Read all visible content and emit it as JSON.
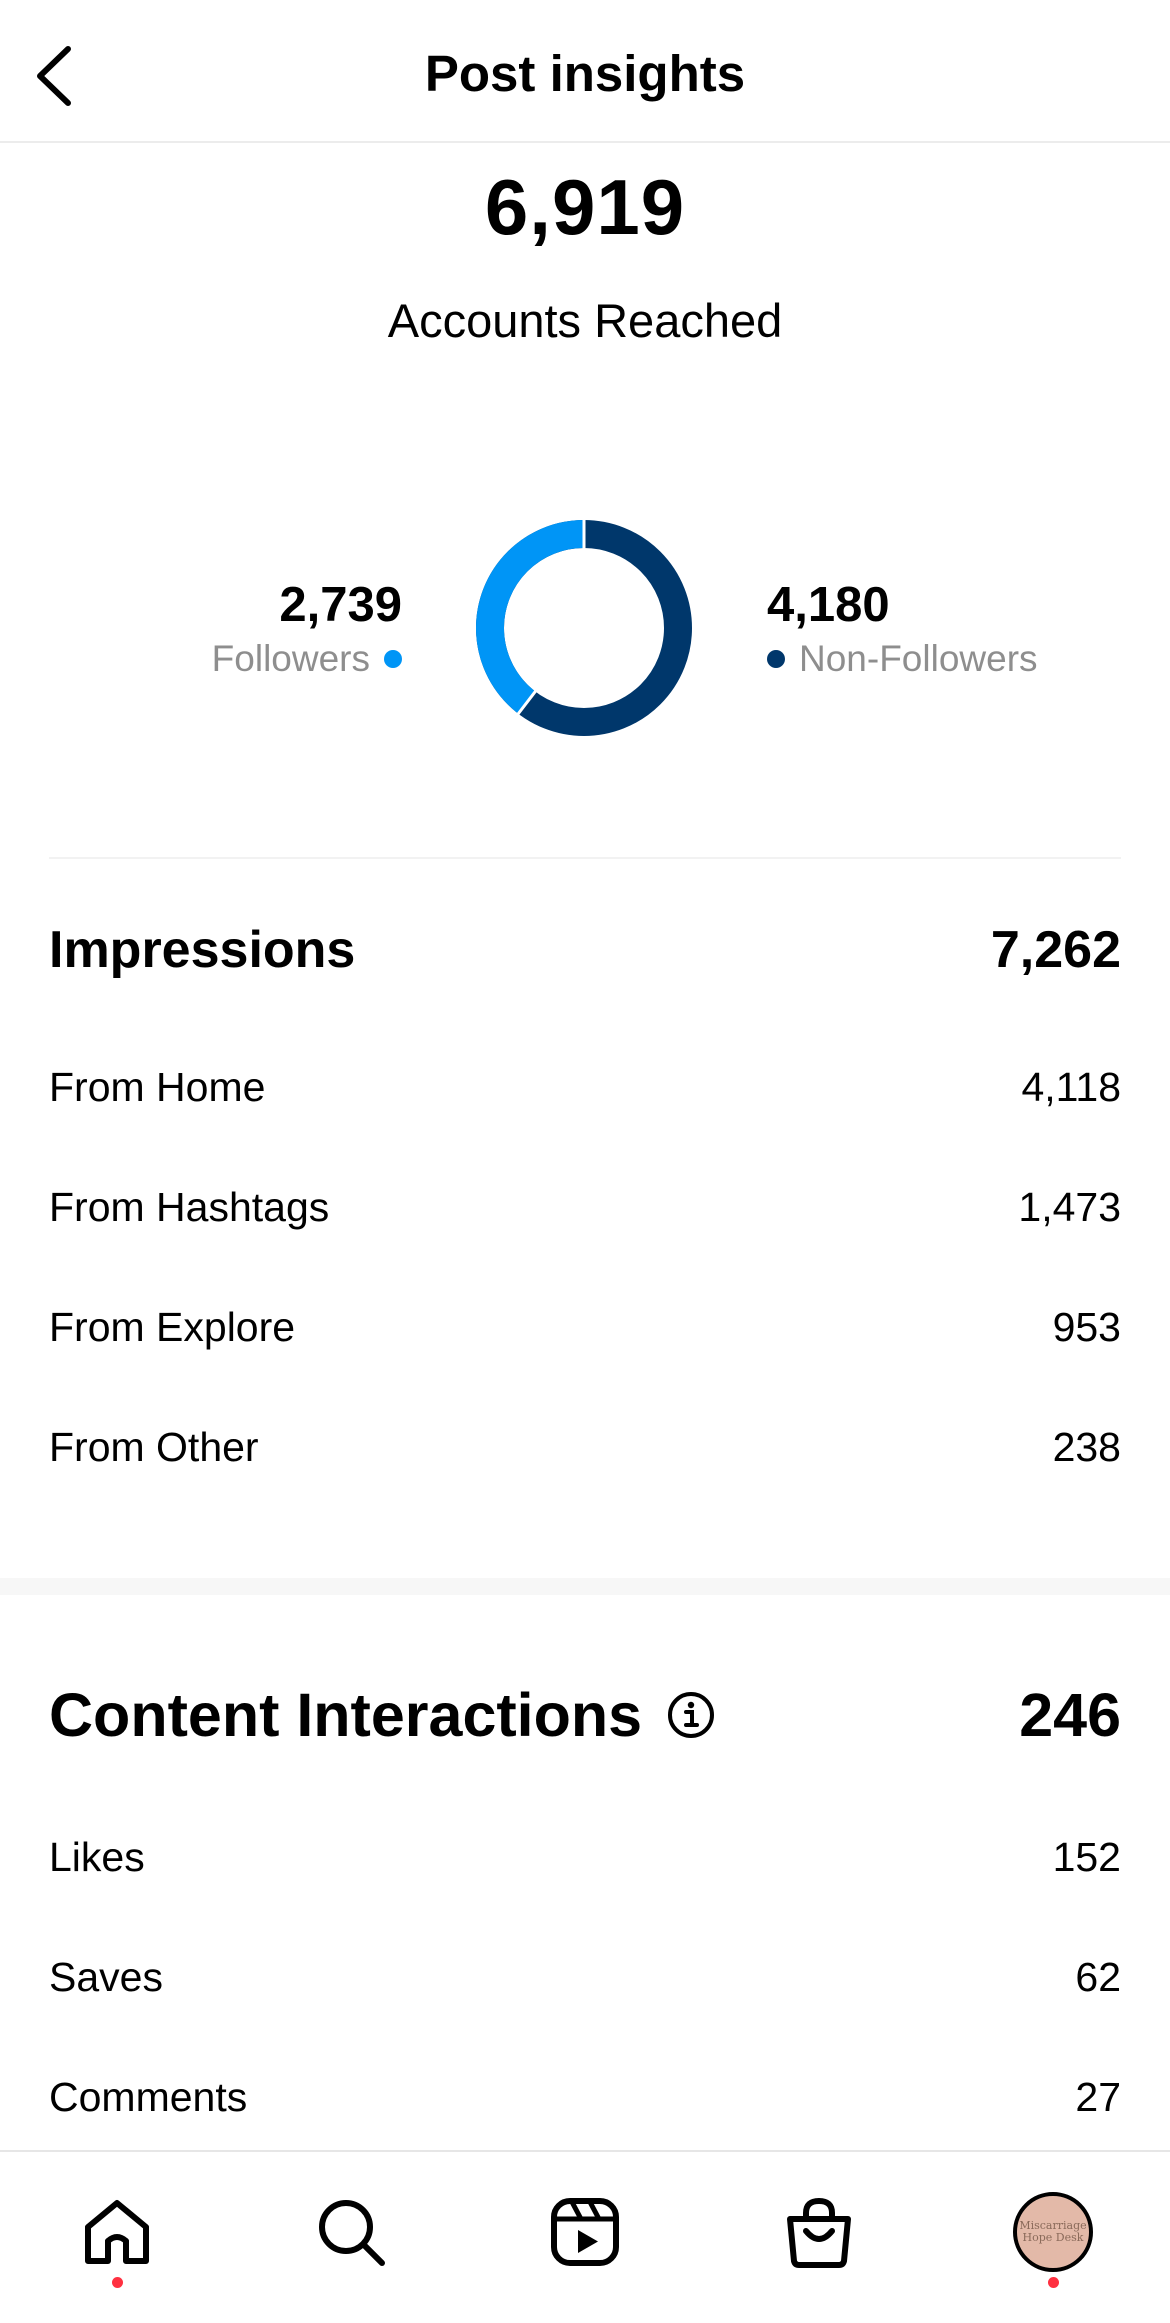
{
  "header": {
    "title": "Post insights",
    "back_icon": "chevron-left-icon"
  },
  "reach": {
    "total": "6,919",
    "label": "Accounts Reached",
    "followers": {
      "value": "2,739",
      "label": "Followers",
      "color": "#0095f6",
      "count": 2739
    },
    "non_followers": {
      "value": "4,180",
      "label": "Non-Followers",
      "color": "#00376b",
      "count": 4180
    }
  },
  "impressions": {
    "title": "Impressions",
    "total": "7,262",
    "rows": [
      {
        "label": "From Home",
        "value": "4,118"
      },
      {
        "label": "From Hashtags",
        "value": "1,473"
      },
      {
        "label": "From Explore",
        "value": "953"
      },
      {
        "label": "From Other",
        "value": "238"
      }
    ]
  },
  "content_interactions": {
    "title": "Content Interactions",
    "info_icon": "info-icon",
    "total": "246",
    "rows": [
      {
        "label": "Likes",
        "value": "152"
      },
      {
        "label": "Saves",
        "value": "62"
      },
      {
        "label": "Comments",
        "value": "27"
      }
    ]
  },
  "tabbar": {
    "items": [
      "home-icon",
      "search-icon",
      "reels-icon",
      "shop-icon",
      "profile-avatar"
    ],
    "avatar_text": "Miscarriage Hope Desk",
    "notification_color": "#ff3040"
  }
}
